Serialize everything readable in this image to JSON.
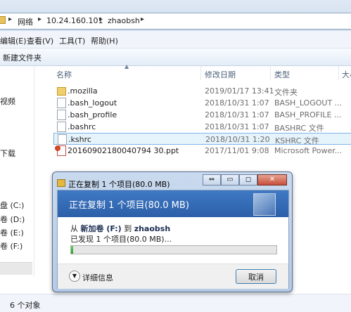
{
  "address": {
    "crumbs": [
      "网络",
      "10.24.160.101",
      "zhaobsh"
    ]
  },
  "menu": [
    "编辑(E)",
    "查看(V)",
    "工具(T)",
    "帮助(H)"
  ],
  "toolbar": {
    "new_folder": "新建文件夹"
  },
  "nav": [
    "视频",
    "下载",
    "盘 (C:)",
    "卷 (D:)",
    "卷 (E:)",
    "卷 (F:)"
  ],
  "columns": {
    "name": "名称",
    "date": "修改日期",
    "type": "类型",
    "size": "大小"
  },
  "files": [
    {
      "name": ".mozilla",
      "date": "2019/01/17 13:41",
      "type": "文件夹",
      "icon": "folder-icon"
    },
    {
      "name": ".bash_logout",
      "date": "2018/10/31 1:07",
      "type": "BASH_LOGOUT ...",
      "icon": "file-icon"
    },
    {
      "name": ".bash_profile",
      "date": "2018/10/31 1:07",
      "type": "BASH_PROFILE ...",
      "icon": "file-icon"
    },
    {
      "name": ".bashrc",
      "date": "2018/10/31 1:07",
      "type": "BASHRC 文件",
      "icon": "file-icon"
    },
    {
      "name": ".kshrc",
      "date": "2018/10/31 1:20",
      "type": "KSHRC 文件",
      "icon": "file-icon"
    },
    {
      "name": "20160902180040794 30.ppt",
      "date": "2017/11/01 9:08",
      "type": "Microsoft Power...",
      "icon": "ppt-icon"
    }
  ],
  "status": {
    "count": "6 个对象"
  },
  "dialog": {
    "title": "正在复制 1 个项目(80.0 MB)",
    "heading": "正在复制 1 个项目(80.0 MB)",
    "from_prefix": "从",
    "from_source": "新加卷 (F:)",
    "to_word": "到",
    "to_dest": "zhaobsh",
    "discovered": "已发现 1 个项目(80.0 MB)...",
    "progress_fraction": 0.01,
    "details": "详细信息",
    "cancel": "取消",
    "accent": "#2c5fa8"
  }
}
